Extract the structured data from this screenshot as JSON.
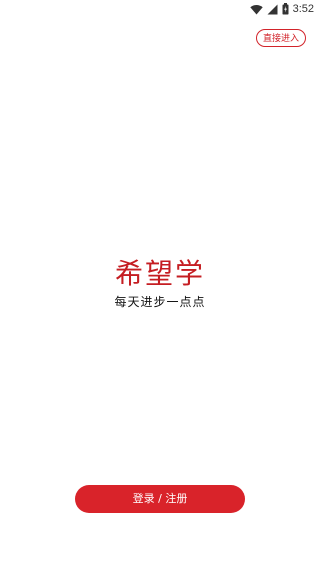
{
  "status_bar": {
    "time": "3:52",
    "icons": [
      "wifi-icon",
      "signal-icon",
      "battery-icon"
    ]
  },
  "header": {
    "skip_label": "直接进入"
  },
  "brand": {
    "title": "希望学",
    "slogan": "每天进步一点点"
  },
  "actions": {
    "login_label": "登录 / 注册"
  },
  "colors": {
    "accent": "#d9232a",
    "text_dark": "#111111",
    "background": "#ffffff"
  }
}
